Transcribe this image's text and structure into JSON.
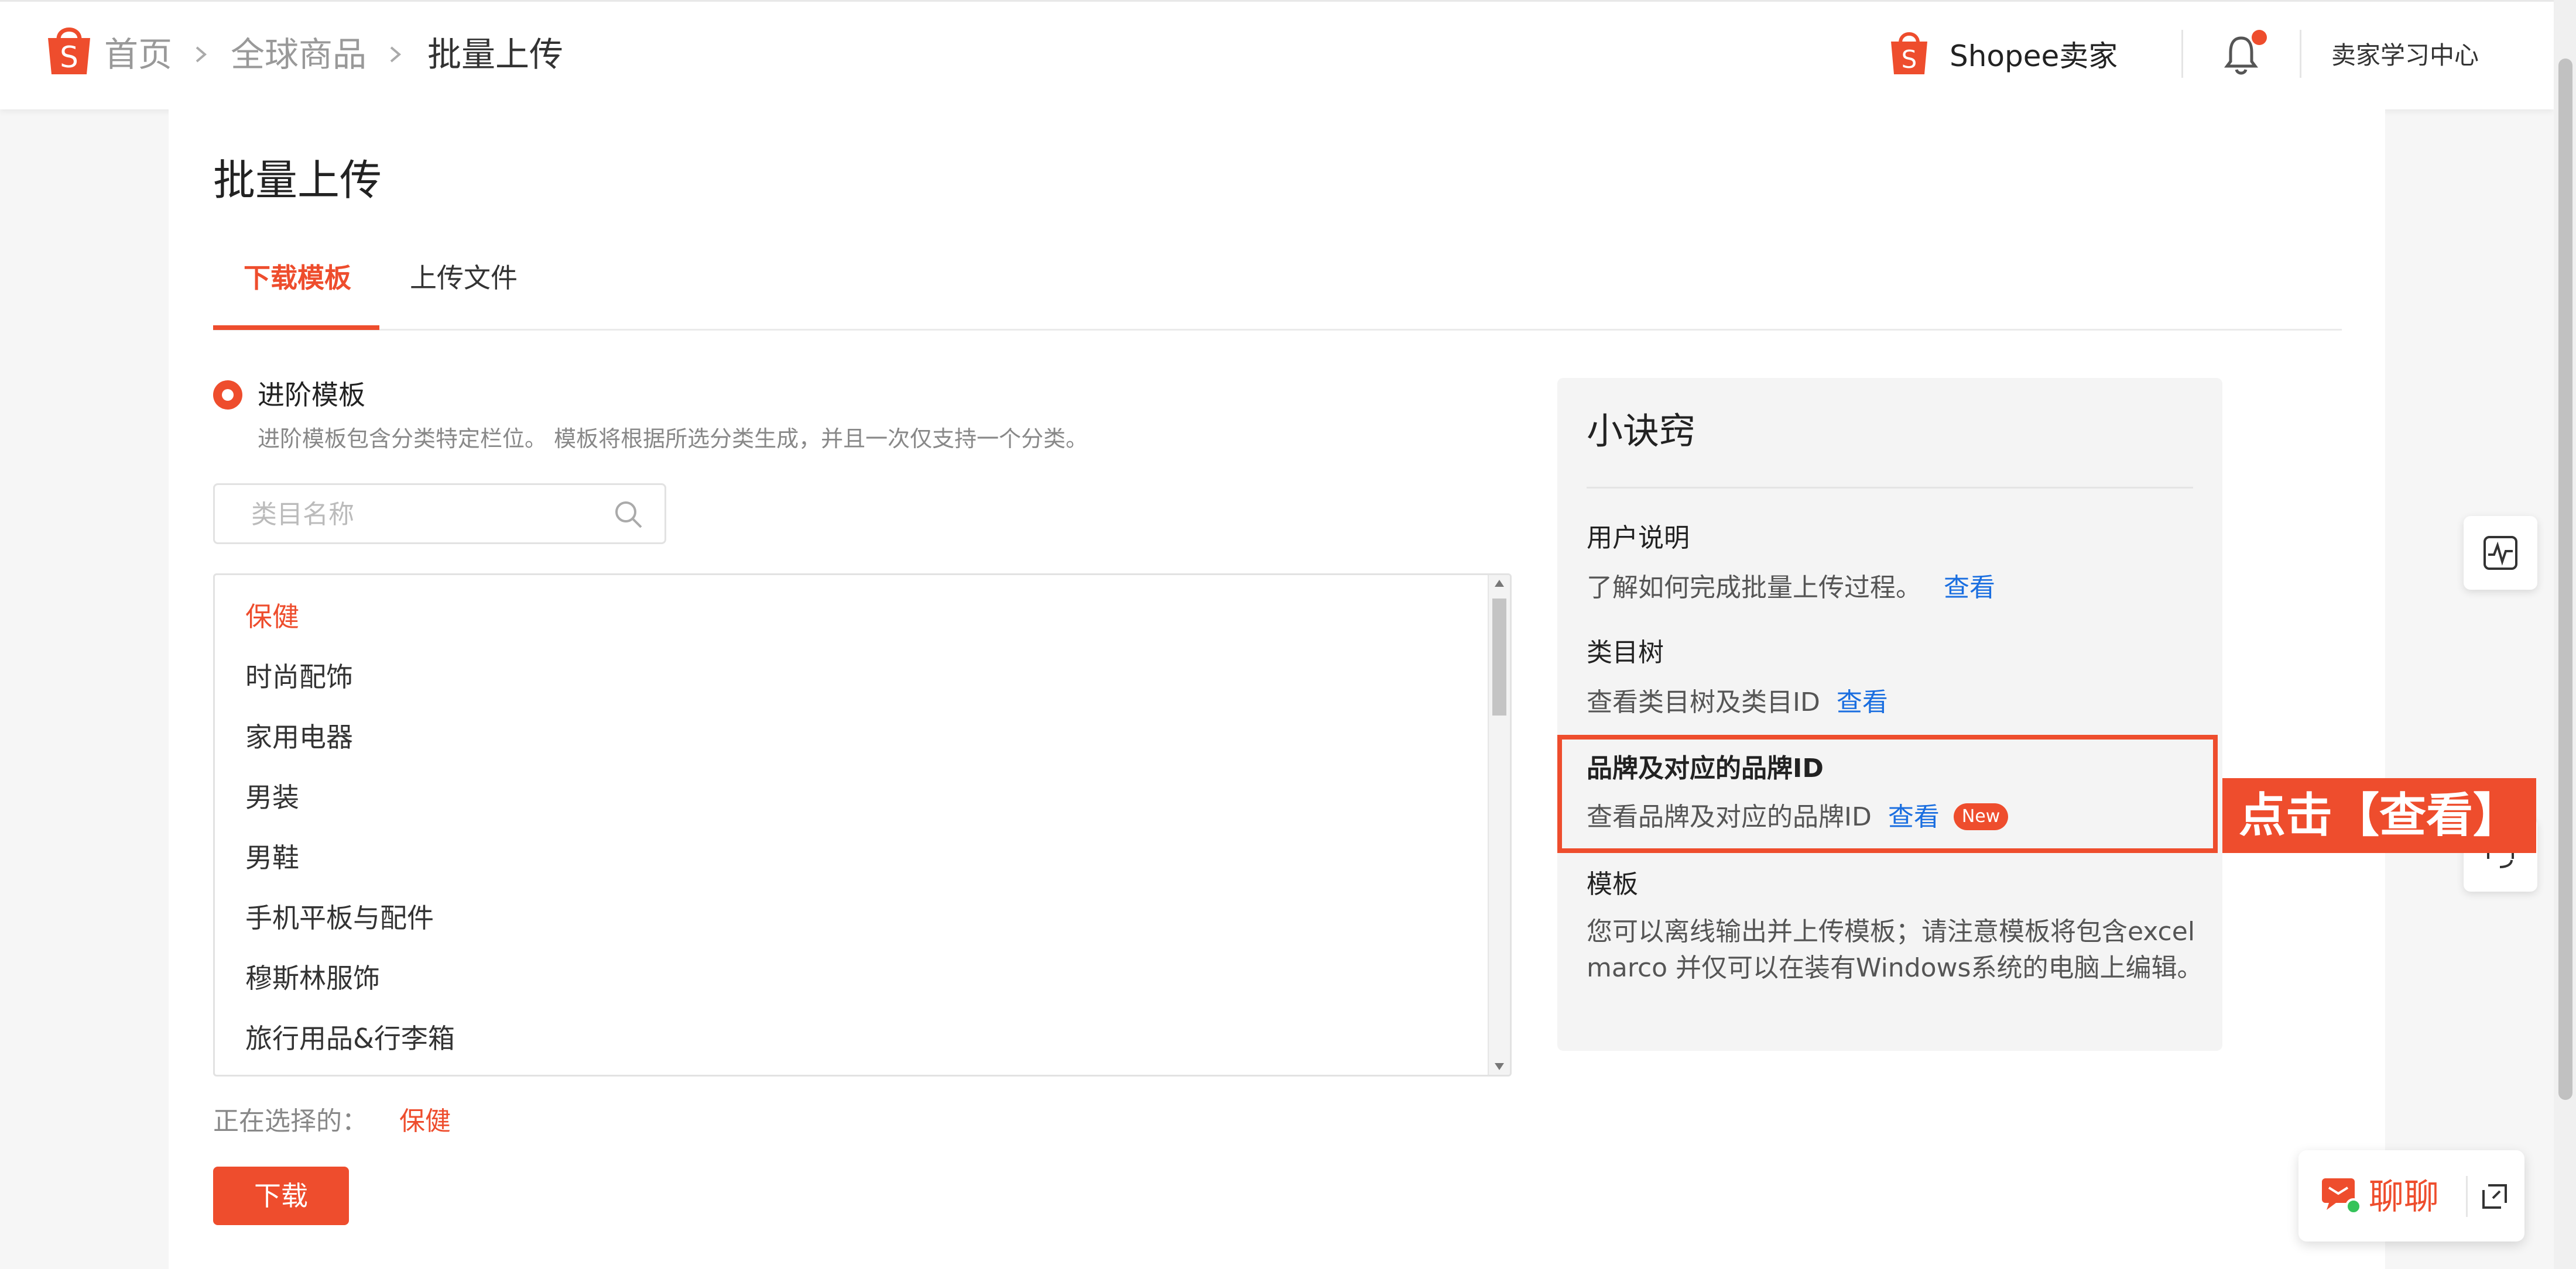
{
  "header": {
    "breadcrumbs": [
      "首页",
      "全球商品",
      "批量上传"
    ],
    "seller_brand": "Shopee卖家",
    "learning_center": "卖家学习中心"
  },
  "page": {
    "title": "批量上传",
    "tabs": [
      {
        "label": "下载模板",
        "active": true
      },
      {
        "label": "上传文件",
        "active": false
      }
    ]
  },
  "template_option": {
    "label": "进阶模板",
    "description": "进阶模板包含分类特定栏位。 模板将根据所选分类生成，并且一次仅支持一个分类。",
    "selected": true
  },
  "search": {
    "placeholder": "类目名称",
    "value": ""
  },
  "categories": [
    "保健",
    "时尚配饰",
    "家用电器",
    "男装",
    "男鞋",
    "手机平板与配件",
    "穆斯林服饰",
    "旅行用品&行李箱"
  ],
  "selected_category_index": 0,
  "selection": {
    "label": "正在选择的：",
    "value": "保健"
  },
  "download_button": "下载",
  "tips": {
    "title": "小诀窍",
    "items": [
      {
        "heading": "用户说明",
        "text": "了解如何完成批量上传过程。",
        "link": "查看"
      },
      {
        "heading": "类目树",
        "text": "查看类目树及类目ID",
        "link": "查看"
      },
      {
        "heading": "品牌及对应的品牌ID",
        "text": "查看品牌及对应的品牌ID",
        "link": "查看",
        "badge": "New"
      },
      {
        "heading": "模板",
        "text": "您可以离线输出并上传模板；请注意模板将包含excel marco 并仅可以在装有Windows系统的电脑上编辑。"
      }
    ]
  },
  "annotation": {
    "callout": "点击【查看】"
  },
  "chat": {
    "label": "聊聊"
  },
  "colors": {
    "brand": "#ee4d2d",
    "link": "#1a6ee0"
  },
  "icons": [
    "shopee-logo-icon",
    "chevron-right-icon",
    "bell-icon",
    "search-icon",
    "activity-icon",
    "headset-icon",
    "chat-icon",
    "expand-icon"
  ]
}
